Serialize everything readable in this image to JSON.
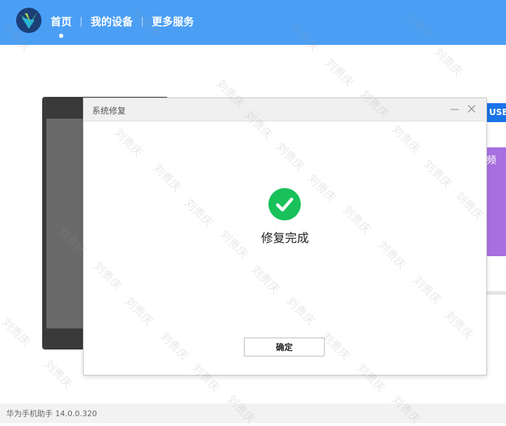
{
  "nav": {
    "items": [
      {
        "label": "首页",
        "active": true
      },
      {
        "label": "我的设备",
        "active": false
      },
      {
        "label": "更多服务",
        "active": false
      }
    ]
  },
  "background": {
    "usb_label": "USB",
    "card_text": "频"
  },
  "dialog": {
    "title": "系统修复",
    "minimize_icon": "minimize-icon",
    "close_icon": "close-icon",
    "status_icon": "check-circle-icon",
    "message": "修复完成",
    "confirm_label": "确定"
  },
  "footer": {
    "app_version": "华为手机助手 14.0.0.320"
  },
  "watermark": "刘贵庆",
  "colors": {
    "topbar": "#4a9ff5",
    "success": "#18c15a",
    "usb": "#1a73e8",
    "card": "#a86fe0"
  }
}
